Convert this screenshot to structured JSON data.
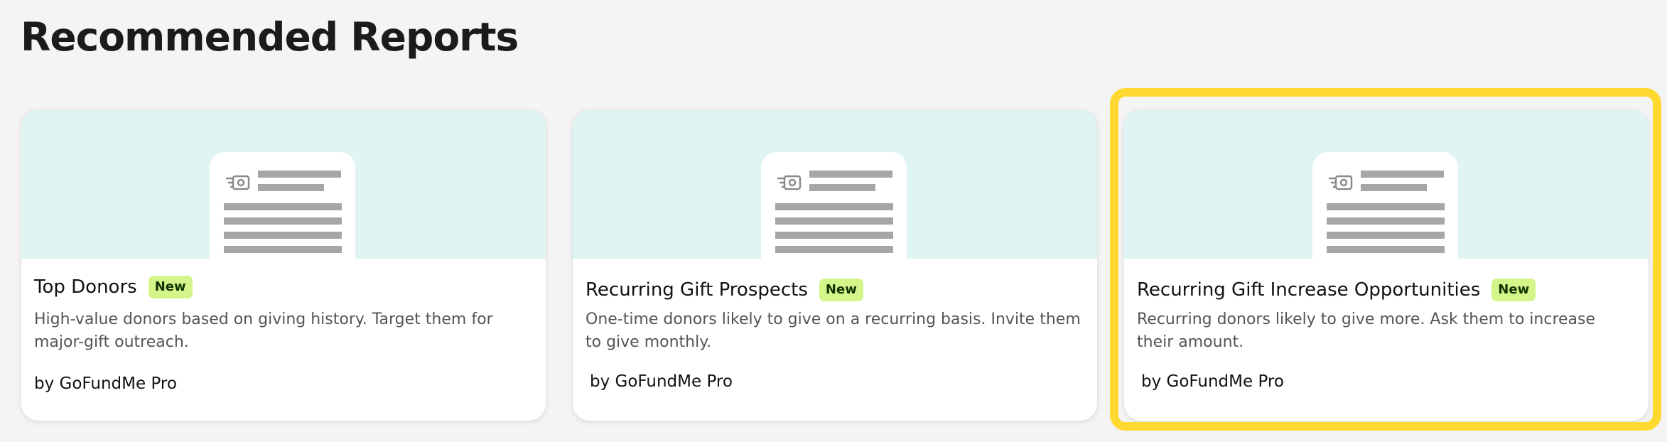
{
  "page": {
    "title": "Recommended Reports"
  },
  "cards": [
    {
      "title": "Top Donors",
      "badge": "New",
      "description": "High-value donors based on giving history. Target them for major-gift outreach.",
      "byline": "by GoFundMe Pro",
      "icon": "report-document-icon"
    },
    {
      "title": "Recurring Gift Prospects",
      "badge": "New",
      "description": "One-time donors likely to give on a recurring basis. Invite them to give monthly.",
      "byline": "by GoFundMe Pro",
      "icon": "report-document-icon"
    },
    {
      "title": "Recurring Gift Increase Opportunities",
      "badge": "New",
      "description": "Recurring donors likely to give more. Ask them to increase their amount.",
      "byline": "by GoFundMe Pro",
      "icon": "report-document-icon",
      "highlighted": true
    }
  ],
  "colors": {
    "background": "#f4f4f4",
    "card_banner": "#e0f4f4",
    "badge_bg": "#d4f58a",
    "highlight_border": "#ffd92f",
    "doc_lines": "#a6a6a6"
  }
}
